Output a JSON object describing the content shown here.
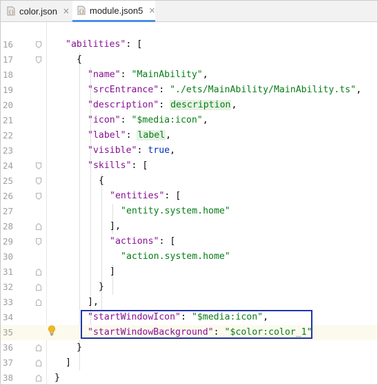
{
  "tabs": [
    {
      "label": "color.json",
      "close": "×",
      "active": false
    },
    {
      "label": "module.json5",
      "close": "×",
      "active": true
    }
  ],
  "line_numbers": [
    "16",
    "17",
    "18",
    "19",
    "20",
    "21",
    "22",
    "23",
    "24",
    "25",
    "26",
    "27",
    "28",
    "29",
    "30",
    "31",
    "32",
    "33",
    "34",
    "35",
    "36",
    "37",
    "38"
  ],
  "code": {
    "l16_key": "\"abilities\"",
    "l16_rest": ": [",
    "l17": "{",
    "l18_key": "\"name\"",
    "l18_sep": ": ",
    "l18_val": "\"MainAbility\"",
    "l18_end": ",",
    "l19_key": "\"srcEntrance\"",
    "l19_sep": ": ",
    "l19_val": "\"./ets/MainAbility/MainAbility.ts\"",
    "l19_end": ",",
    "l20_key": "\"description\"",
    "l20_sep": ": ",
    "l20_val": "description",
    "l20_end": ",",
    "l21_key": "\"icon\"",
    "l21_sep": ": ",
    "l21_val": "\"$media:icon\"",
    "l21_end": ",",
    "l22_key": "\"label\"",
    "l22_sep": ": ",
    "l22_val": "label",
    "l22_end": ",",
    "l23_key": "\"visible\"",
    "l23_sep": ": ",
    "l23_val": "true",
    "l23_end": ",",
    "l24_key": "\"skills\"",
    "l24_rest": ": [",
    "l25": "{",
    "l26_key": "\"entities\"",
    "l26_rest": ": [",
    "l27_val": "\"entity.system.home\"",
    "l28": "],",
    "l29_key": "\"actions\"",
    "l29_rest": ": [",
    "l30_val": "\"action.system.home\"",
    "l31": "]",
    "l32": "}",
    "l33": "],",
    "l34_key": "\"startWindowIcon\"",
    "l34_sep": ": ",
    "l34_val": "\"$media:icon\"",
    "l34_end": ",",
    "l35_key": "\"startWindowBackground\"",
    "l35_sep": ": ",
    "l35_val": "\"$color:color_1\"",
    "l36": "}",
    "l37": "]",
    "l38": "}"
  },
  "colors": {
    "key": "#871094",
    "string": "#067d17",
    "keyword": "#0033b3",
    "highlight_border": "#2034a8",
    "tab_accent": "#4a8de6"
  },
  "icons": [
    "json-file-icon",
    "json5-file-icon",
    "fold-marker-icon",
    "intention-bulb-icon"
  ]
}
